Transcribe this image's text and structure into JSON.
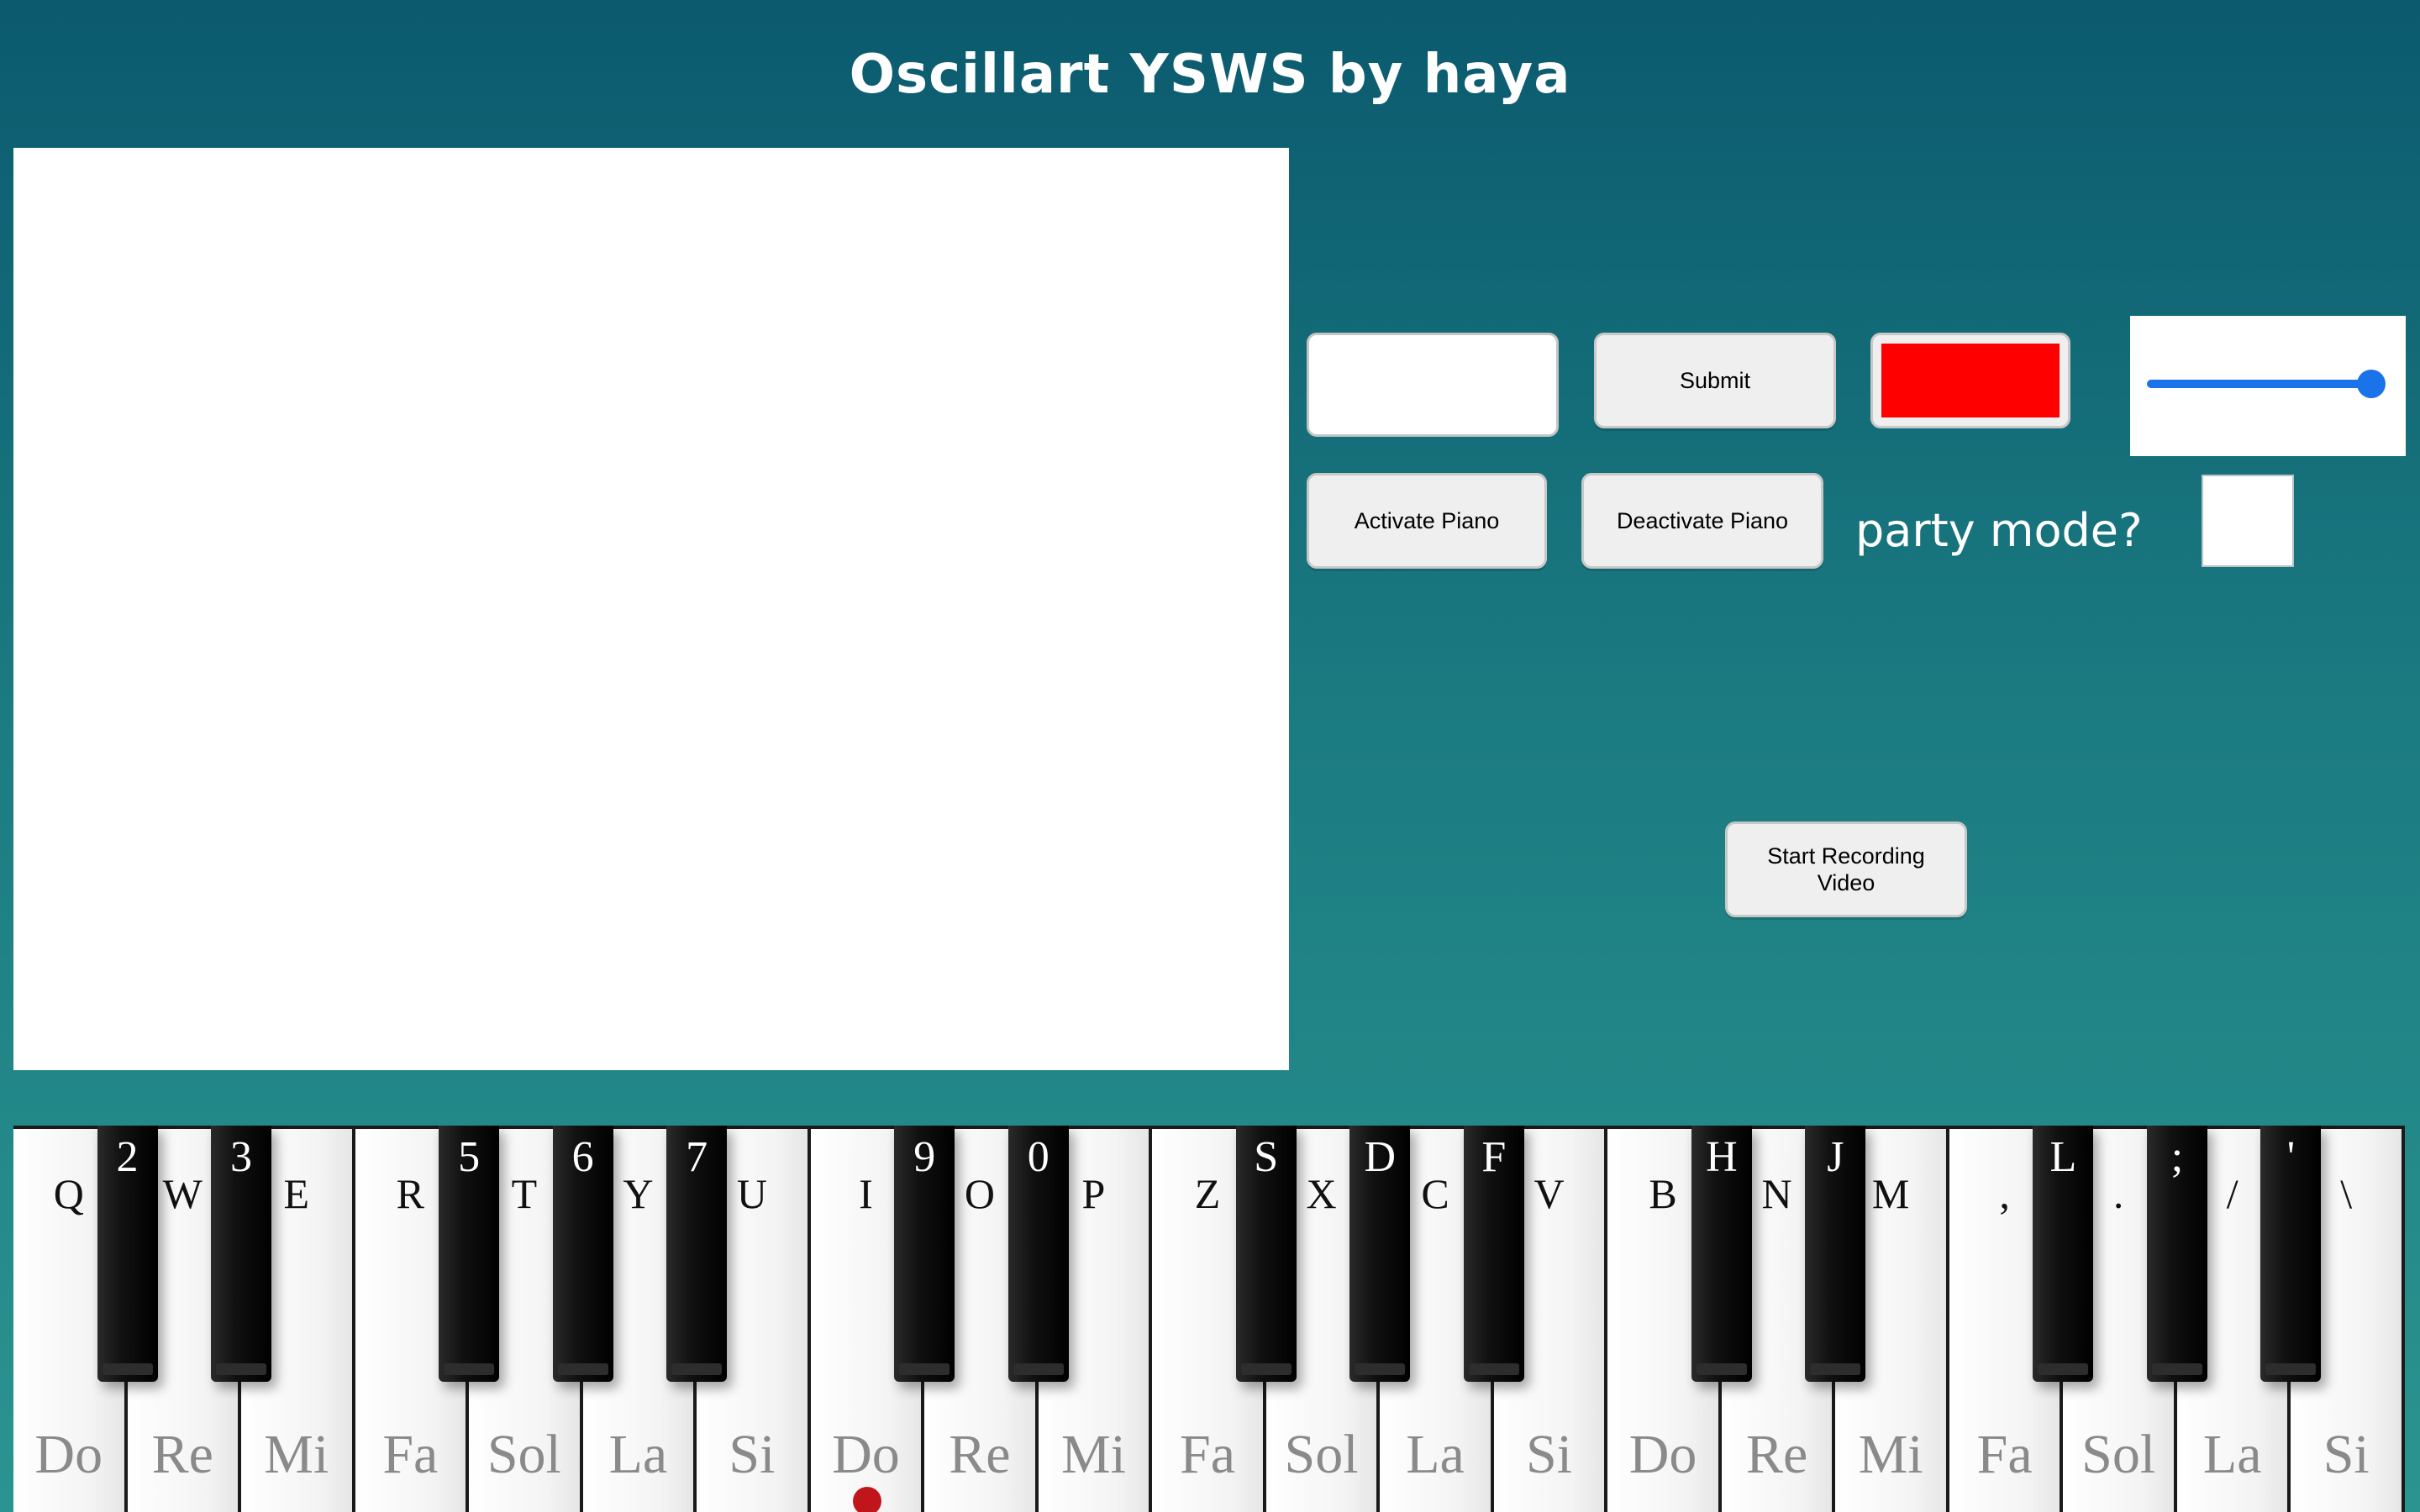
{
  "title": "Oscillart YSWS by haya",
  "controls": {
    "text_input_value": "",
    "submit_label": "Submit",
    "color_value": "#ff0000",
    "slider_value_fraction": 0.96,
    "activate_label": "Activate Piano",
    "deactivate_label": "Deactivate Piano",
    "party_label": "party mode?",
    "party_checked": false,
    "record_label": "Start Recording Video"
  },
  "piano": {
    "white_keys": [
      {
        "key": "Q",
        "note": "Do"
      },
      {
        "key": "W",
        "note": "Re"
      },
      {
        "key": "E",
        "note": "Mi"
      },
      {
        "key": "R",
        "note": "Fa"
      },
      {
        "key": "T",
        "note": "Sol"
      },
      {
        "key": "Y",
        "note": "La"
      },
      {
        "key": "U",
        "note": "Si"
      },
      {
        "key": "I",
        "note": "Do"
      },
      {
        "key": "O",
        "note": "Re"
      },
      {
        "key": "P",
        "note": "Mi"
      },
      {
        "key": "Z",
        "note": "Fa"
      },
      {
        "key": "X",
        "note": "Sol"
      },
      {
        "key": "C",
        "note": "La"
      },
      {
        "key": "V",
        "note": "Si"
      },
      {
        "key": "B",
        "note": "Do"
      },
      {
        "key": "N",
        "note": "Re"
      },
      {
        "key": "M",
        "note": "Mi"
      },
      {
        "key": ",",
        "note": "Fa"
      },
      {
        "key": ".",
        "note": "Sol"
      },
      {
        "key": "/",
        "note": "La"
      },
      {
        "key": "\\",
        "note": "Si"
      }
    ],
    "black_keys": [
      "2",
      "3",
      "5",
      "6",
      "7",
      "9",
      "0",
      "S",
      "D",
      "F",
      "H",
      "J",
      "L",
      ";",
      "'"
    ],
    "black_after_white_index": [
      0,
      1,
      3,
      4,
      5,
      7,
      8,
      10,
      11,
      12,
      14,
      15,
      17,
      18,
      19
    ],
    "marker_on_white_index": 7
  }
}
